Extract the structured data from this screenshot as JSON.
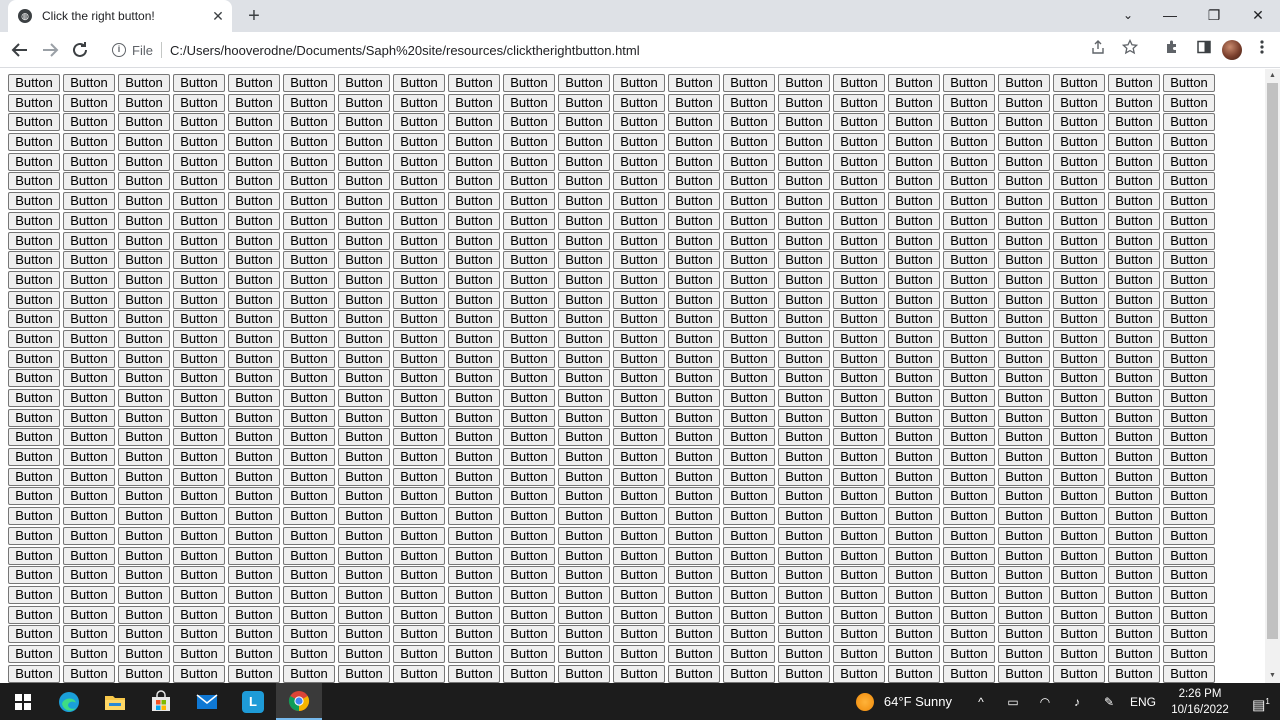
{
  "browser": {
    "tab_title": "Click the right button!",
    "tab_close": "✕",
    "new_tab": "+",
    "address_scheme": "File",
    "address_url": "C:/Users/hooverodne/Documents/Saph%20site/resources/clicktherightbutton.html",
    "window_controls": {
      "tab_search": "⌄",
      "minimize": "—",
      "maximize": "❐",
      "close": "✕"
    }
  },
  "page": {
    "button_label": "Button",
    "columns": 22,
    "rows": 31
  },
  "taskbar": {
    "weather": "64°F  Sunny",
    "language": "ENG",
    "time": "2:26 PM",
    "date": "10/16/2022",
    "notification_count": "1"
  },
  "icons": {
    "browser": [
      "back-arrow-icon",
      "forward-arrow-icon",
      "reload-icon",
      "info-icon",
      "share-icon",
      "bookmark-star-icon",
      "extensions-icon",
      "side-panel-icon",
      "menu-kebab-icon"
    ],
    "taskbar": [
      "windows-start-icon",
      "edge-icon",
      "file-explorer-icon",
      "microsoft-store-icon",
      "mail-icon",
      "l-app-icon",
      "chrome-icon"
    ]
  }
}
